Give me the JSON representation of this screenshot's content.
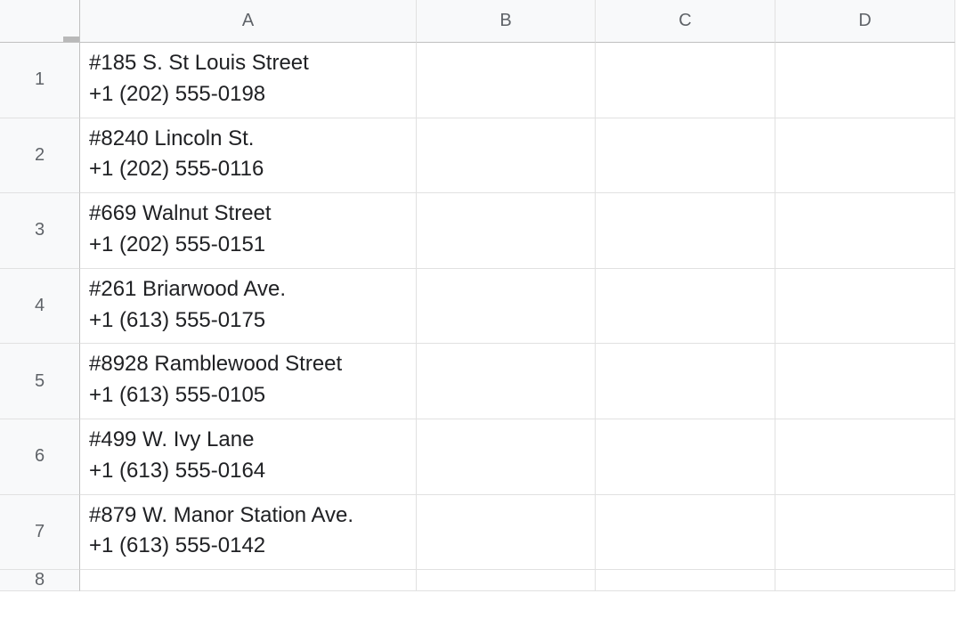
{
  "columns": [
    "A",
    "B",
    "C",
    "D"
  ],
  "rows": [
    {
      "num": "1",
      "a": "#185 S. St Louis Street\n+1 (202) 555-0198",
      "b": "",
      "c": "",
      "d": ""
    },
    {
      "num": "2",
      "a": "#8240 Lincoln St.\n+1 (202) 555-0116",
      "b": "",
      "c": "",
      "d": ""
    },
    {
      "num": "3",
      "a": "#669 Walnut Street\n+1 (202) 555-0151",
      "b": "",
      "c": "",
      "d": ""
    },
    {
      "num": "4",
      "a": "#261 Briarwood Ave.\n+1 (613) 555-0175",
      "b": "",
      "c": "",
      "d": ""
    },
    {
      "num": "5",
      "a": "#8928 Ramblewood Street\n+1 (613) 555-0105",
      "b": "",
      "c": "",
      "d": ""
    },
    {
      "num": "6",
      "a": "#499 W. Ivy Lane\n+1 (613) 555-0164",
      "b": "",
      "c": "",
      "d": ""
    },
    {
      "num": "7",
      "a": "#879 W. Manor Station Ave.\n+1 (613) 555-0142",
      "b": "",
      "c": "",
      "d": ""
    },
    {
      "num": "8",
      "a": "",
      "b": "",
      "c": "",
      "d": "",
      "empty": true
    }
  ]
}
